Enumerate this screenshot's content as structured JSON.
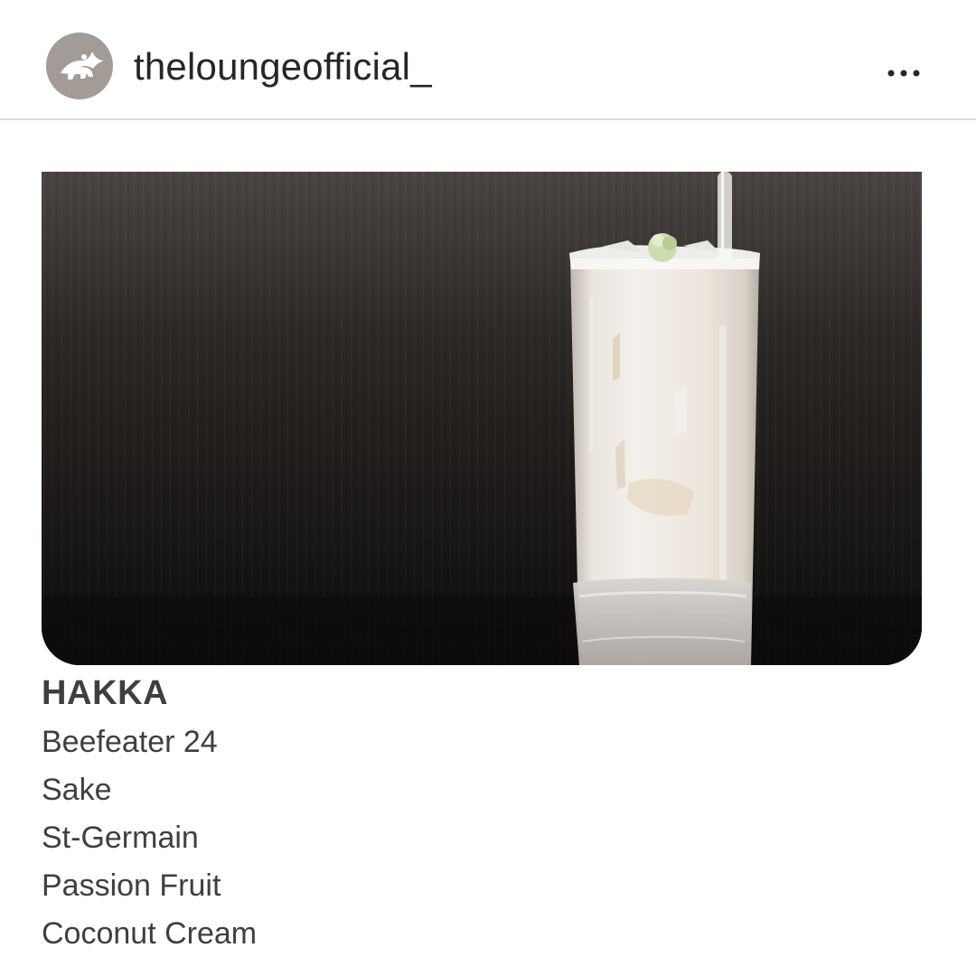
{
  "header": {
    "username": "theloungeofficial_",
    "avatar_icon": "winged-lion-logo",
    "more_icon": "more-horizontal-icon"
  },
  "post": {
    "image_subject": "cocktail-glass",
    "caption": {
      "drink_name": "HAKKA",
      "ingredients": [
        "Beefeater 24",
        "Sake",
        "St-Germain",
        "Passion Fruit",
        "Coconut Cream"
      ]
    }
  },
  "colors": {
    "text": "#262626",
    "caption_text": "#3f3f3f",
    "avatar_bg": "#a39b95",
    "divider": "#dbdbdb",
    "photo_bg": "#1b1918"
  }
}
